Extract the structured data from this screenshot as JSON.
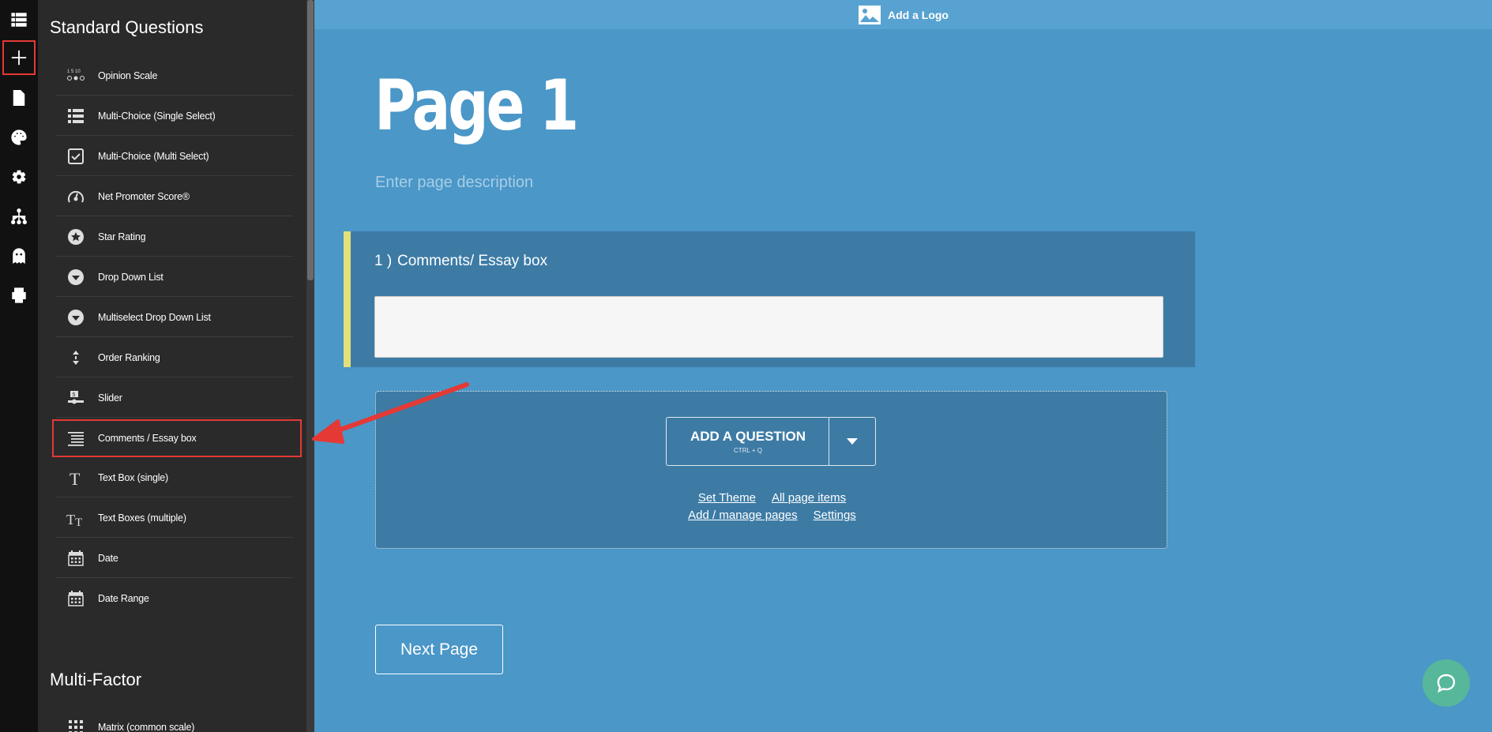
{
  "panel": {
    "standard_title": "Standard Questions",
    "multifactor_title": "Multi-Factor",
    "items": [
      {
        "label": "Opinion Scale",
        "icon": "opinion-scale-icon"
      },
      {
        "label": "Multi-Choice (Single Select)",
        "icon": "list-icon"
      },
      {
        "label": "Multi-Choice (Multi Select)",
        "icon": "checkbox-icon"
      },
      {
        "label": "Net Promoter Score®",
        "icon": "gauge-icon"
      },
      {
        "label": "Star Rating",
        "icon": "star-icon"
      },
      {
        "label": "Drop Down List",
        "icon": "dropdown-icon"
      },
      {
        "label": "Multiselect Drop Down List",
        "icon": "multiselect-dropdown-icon"
      },
      {
        "label": "Order Ranking",
        "icon": "ranking-icon"
      },
      {
        "label": "Slider",
        "icon": "slider-icon"
      },
      {
        "label": "Comments / Essay box",
        "icon": "essay-icon"
      },
      {
        "label": "Text Box (single)",
        "icon": "text-single-icon"
      },
      {
        "label": "Text Boxes (multiple)",
        "icon": "text-multiple-icon"
      },
      {
        "label": "Date",
        "icon": "calendar-icon"
      },
      {
        "label": "Date Range",
        "icon": "calendar-range-icon"
      }
    ],
    "multifactor_items": [
      {
        "label": "Matrix (common scale)",
        "icon": "matrix-icon"
      }
    ]
  },
  "logo_bar": {
    "label": "Add a Logo"
  },
  "page": {
    "title": "Page 1",
    "description_placeholder": "Enter page description"
  },
  "question": {
    "number": "1 )",
    "text": "Comments/ Essay box"
  },
  "add_question": {
    "label": "ADD A QUESTION",
    "shortcut": "CTRL + Q",
    "links_row1": [
      "Set Theme",
      "All page items"
    ],
    "links_row2": [
      "Add / manage pages",
      "Settings"
    ]
  },
  "next_button": "Next Page",
  "colors": {
    "canvas": "#4a97c8",
    "panel": "#2a2a2a",
    "rail": "#111111",
    "highlight": "#e53935",
    "accent": "#e3e07a",
    "chat": "#56b79a"
  }
}
